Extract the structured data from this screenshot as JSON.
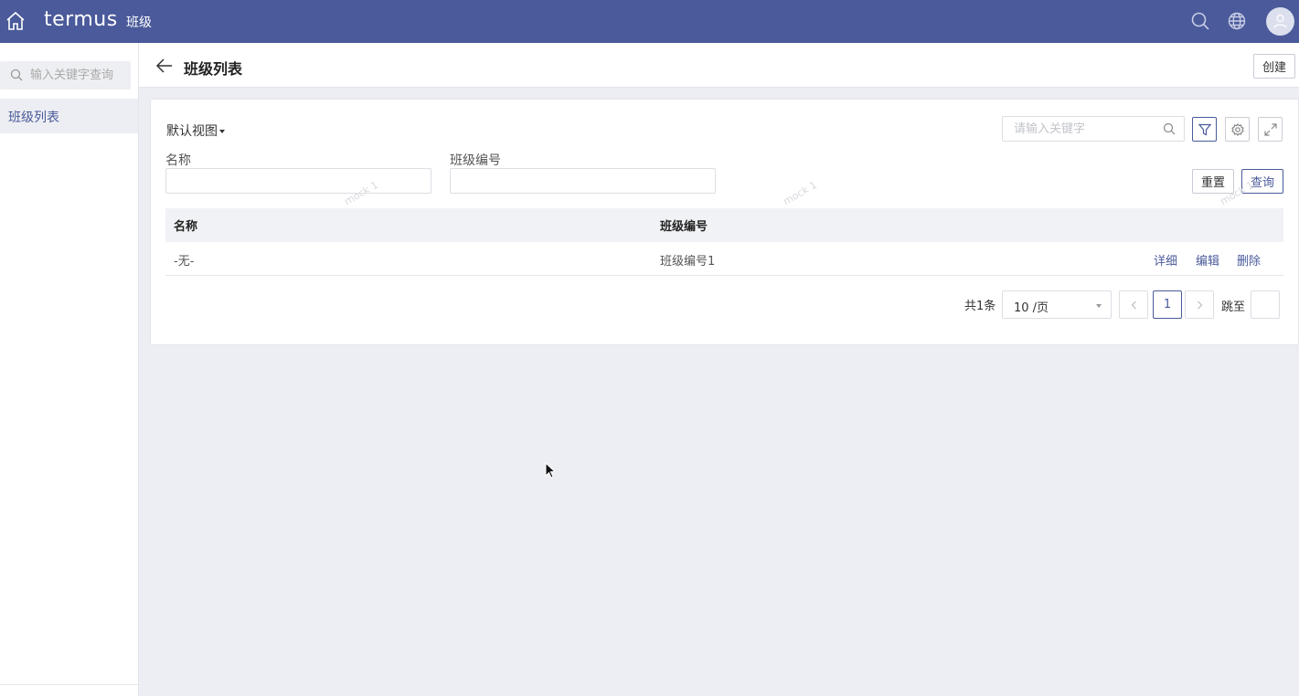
{
  "topbar": {
    "logo": "termus",
    "app_title": "班级",
    "icons": [
      "home-icon",
      "search-icon",
      "globe-icon",
      "user-avatar"
    ]
  },
  "sidebar": {
    "search_placeholder": "输入关键字查询",
    "items": [
      {
        "label": "班级列表",
        "active": true
      }
    ]
  },
  "header": {
    "title": "班级列表",
    "create_label": "创建"
  },
  "filter": {
    "view_label": "默认视图",
    "keyword_placeholder": "请输入关键字",
    "fields": [
      {
        "label": "名称",
        "value": ""
      },
      {
        "label": "班级编号",
        "value": ""
      }
    ],
    "reset_label": "重置",
    "query_label": "查询"
  },
  "table": {
    "columns": [
      "名称",
      "班级编号"
    ],
    "rows": [
      {
        "name": "-无-",
        "code": "班级编号1",
        "actions": [
          "详细",
          "编辑",
          "删除"
        ]
      }
    ],
    "watermark": "mock 1"
  },
  "pagination": {
    "total": "共1条",
    "page_size": "10 /页",
    "current_page": "1",
    "jump_label": "跳至"
  },
  "colors": {
    "primary": "#4a5a9a",
    "background": "#edeef3"
  }
}
